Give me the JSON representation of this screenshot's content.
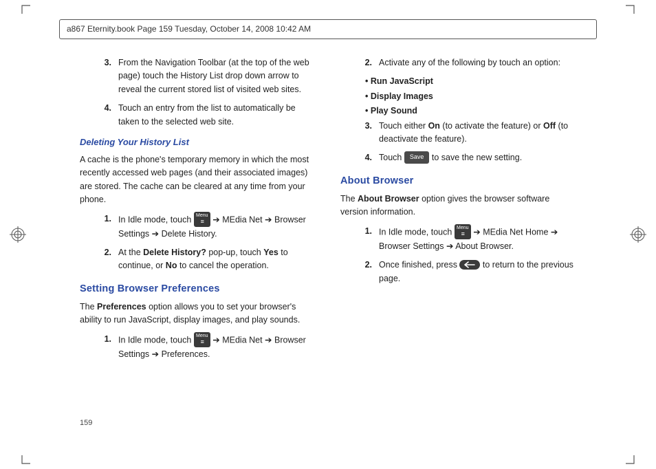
{
  "header": "a867 Eternity.book  Page 159  Tuesday, October 14, 2008  10:42 AM",
  "page_number": "159",
  "left": {
    "step3_n": "3.",
    "step3": "From the Navigation Toolbar (at the top of the web page) touch the History List drop down arrow to reveal the current stored list of visited web sites.",
    "step4_n": "4.",
    "step4": "Touch an entry from the list to automatically be taken to the selected web site.",
    "h_delete": "Deleting Your History List",
    "delete_para": "A cache is the phone's temporary memory in which the most recently accessed web pages (and their associated images) are stored. The cache can be cleared at any time from your phone.",
    "d1_n": "1.",
    "d1_a": "In Idle mode, touch ",
    "d1_b": " ➔ MEdia Net ➔ Browser Settings  ➔ Delete History",
    "d2_n": "2.",
    "d2_a": "At the ",
    "d2_b": "Delete History?",
    "d2_c": " pop-up, touch ",
    "d2_d": "Yes",
    "d2_e": " to continue, or ",
    "d2_f": "No",
    "d2_g": " to cancel the operation.",
    "h_pref": "Setting Browser Preferences",
    "pref_para_a": "The ",
    "pref_para_b": "Preferences",
    "pref_para_c": " option allows you to set your browser's ability to run JavaScript, display images, and play sounds.",
    "p1_n": "1.",
    "p1_a": "In Idle mode, touch ",
    "p1_b": " ➔ MEdia Net ➔ Browser Settings  ➔ Preferences",
    "menu_label": "Menu"
  },
  "right": {
    "s2_n": "2.",
    "s2": "Activate any of the following by touch an option:",
    "b1": "Run JavaScript",
    "b2": "Display Images",
    "b3": "Play Sound",
    "s3_n": "3.",
    "s3_a": "Touch either ",
    "s3_b": "On",
    "s3_c": " (to activate the feature) or ",
    "s3_d": "Off",
    "s3_e": " (to deactivate the feature).",
    "s4_n": "4.",
    "s4_a": "Touch ",
    "s4_b": " to save the new setting.",
    "save_label": "Save",
    "h_about": "About Browser",
    "about_para_a": "The ",
    "about_para_b": "About Browser",
    "about_para_c": " option gives the browser software version information.",
    "a1_n": "1.",
    "a1_a": "In Idle mode, touch ",
    "a1_b": " ➔ MEdia Net Home ➔ Browser Settings  ➔ About Browser",
    "a2_n": "2.",
    "a2_a": "Once finished, press ",
    "a2_b": " to return to the previous page.",
    "menu_label": "Menu"
  }
}
